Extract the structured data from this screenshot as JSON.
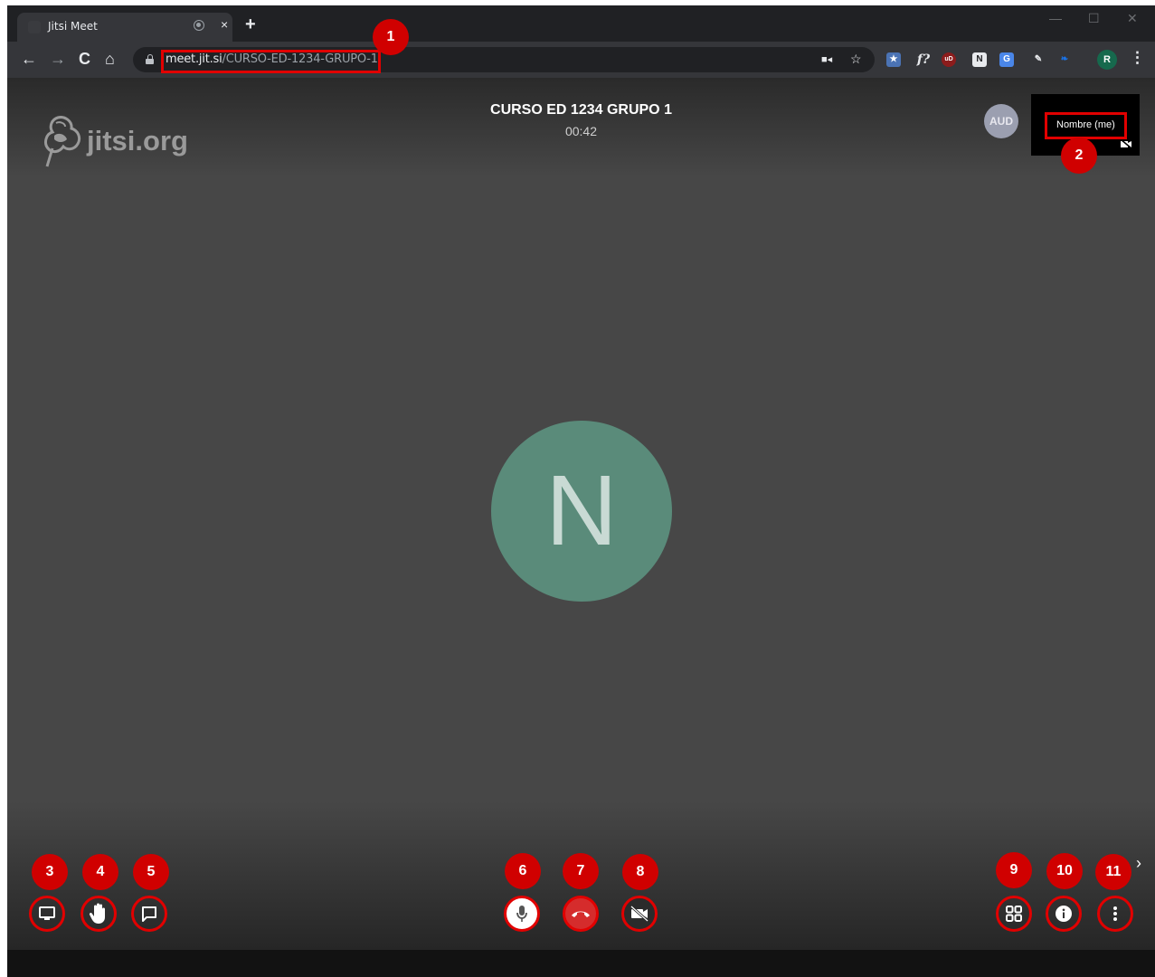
{
  "browser": {
    "tab_title": "Jitsi Meet",
    "tab_close": "×",
    "new_tab": "+",
    "url_host": "meet.jit.si",
    "url_path": "/CURSO-ED-1234-GRUPO-1",
    "profile_initial": "R",
    "extensions": [
      "f?",
      "uD",
      "N"
    ]
  },
  "meeting": {
    "logo_text": "jitsi.org",
    "title": "CURSO ED 1234 GRUPO 1",
    "timer": "00:42",
    "audio_participant": "AUD",
    "self_name": "Nombre (me)",
    "main_avatar_initial": "N"
  },
  "annotations": [
    "1",
    "2",
    "3",
    "4",
    "5",
    "6",
    "7",
    "8",
    "9",
    "10",
    "11"
  ],
  "colors": {
    "annotation_red": "#e10000",
    "avatar_green": "#5a8b7a",
    "hangup_red": "#d52c2c"
  }
}
